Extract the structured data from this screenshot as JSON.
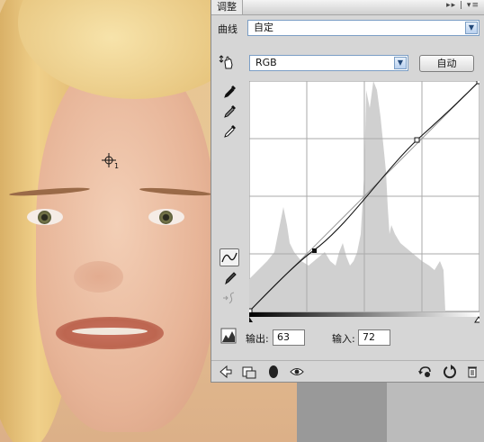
{
  "panel": {
    "tab_label": "调整",
    "title_controls": "▸▸ | ▾≡"
  },
  "preset": {
    "label": "曲线",
    "value": "自定"
  },
  "channel": {
    "value": "RGB"
  },
  "auto_button": {
    "label": "自动"
  },
  "tools": {
    "on_image": "hand-pointer-icon",
    "black_point": "eyedropper-black-icon",
    "gray_point": "eyedropper-gray-icon",
    "white_point": "eyedropper-white-icon",
    "curve_points": "curve-edit-icon",
    "pencil": "pencil-icon",
    "smooth": "smooth-curve-icon"
  },
  "curve": {
    "output_label": "输出:",
    "output_value": "63",
    "input_label": "输入:",
    "input_value": "72"
  },
  "canvas_cursor": {
    "sample_number": "1"
  },
  "bottom_icons": [
    "back-arrow-icon",
    "clip-to-layer-icon",
    "visibility-circle-icon",
    "eye-icon",
    "view-previous-state-icon",
    "reset-icon",
    "trash-icon"
  ],
  "colors": {
    "panel_bg": "#d6d6d6",
    "focus_border": "#7b9ec5",
    "histogram": "#d0d0d0"
  }
}
